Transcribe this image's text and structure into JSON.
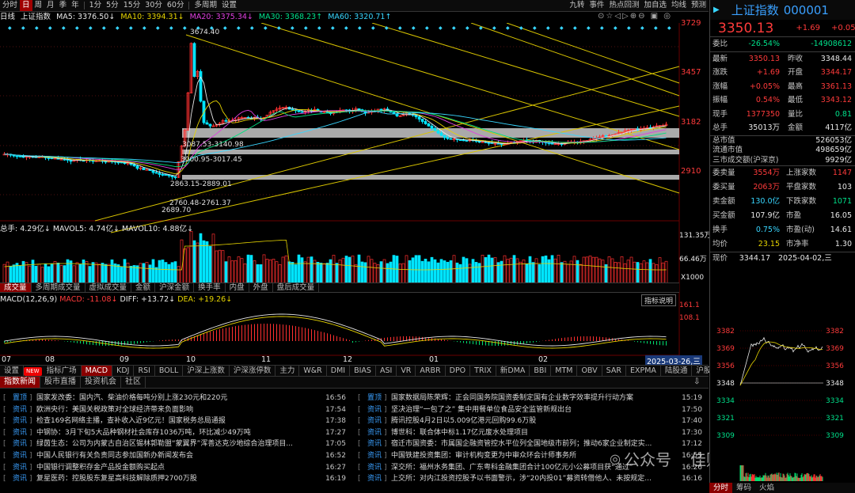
{
  "toolbar": {
    "items": [
      "分时",
      "日",
      "周",
      "月",
      "季",
      "年",
      "1分",
      "5分",
      "15分",
      "30分",
      "60分",
      "多周期",
      "设置"
    ],
    "active": "日",
    "right": [
      "九转",
      "事件",
      "热点回测",
      "加自选",
      "均线",
      "预测"
    ]
  },
  "ma_line": {
    "period": "日线",
    "title": "上证指数",
    "ma5": "MA5: 3376.50↓",
    "ma10": "MA10: 3394.31↓",
    "ma20": "MA20: 3375.34↓",
    "ma30": "MA30: 3368.23↑",
    "ma60": "MA60: 3320.71↑"
  },
  "price_axis": [
    "3729",
    "3457",
    "3182",
    "2910"
  ],
  "chart_annotations": {
    "high": "3674.40",
    "low": "2689.70",
    "zone1": "3087.53-3140.98",
    "zone2": "3000.95-3017.45",
    "zone3": "2863.15-2889.01",
    "zone4": "2760.48-2761.37"
  },
  "volume": {
    "header": "总手: 4.29亿↓  MAVOL5: 4.74亿↓  MAVOL10: 4.88亿↓",
    "axis": [
      "131.35万",
      "66.46万",
      "X1000"
    ]
  },
  "vol_tabs": [
    "成交量",
    "多周期成交量",
    "虚拟成交量",
    "金额",
    "沪深金额",
    "换手率",
    "内盘",
    "外盘",
    "盘后成交量"
  ],
  "macd": {
    "label": "MACD(12,26,9)",
    "macd": "MACD: -11.08↓",
    "diff": "DIFF: +13.72↓",
    "dea": "DEA: +19.26↓",
    "axis": [
      "161.1",
      "108.1"
    ],
    "explain": "指标说明"
  },
  "date_axis": [
    "07",
    "08",
    "09",
    "10",
    "11",
    "12",
    "01",
    "02"
  ],
  "current_date": "2025-03-26,三",
  "indicator_tabs": [
    "设置",
    "NEW",
    "指标广场",
    "MACD",
    "KDJ",
    "RSI",
    "BOLL",
    "沪深上涨数",
    "沪深涨停数",
    "主力",
    "W&R",
    "DMI",
    "BIAS",
    "ASI",
    "VR",
    "ARBR",
    "DPO",
    "TRIX",
    "新DMA",
    "BBI",
    "MTM",
    "OBV",
    "SAR",
    "EXPMA",
    "陆股通",
    "沪股通",
    "深"
  ],
  "news_tabs": [
    "指数新闻",
    "股市直播",
    "投资机会",
    "社区"
  ],
  "news_left": [
    {
      "tag": "置顶",
      "title": "国家发改委：国内汽、柴油价格每吨分别上涨230元和220元",
      "time": "16:56"
    },
    {
      "tag": "资讯",
      "title": "欧洲央行：美国关税政策对全球经济带来负面影响",
      "time": "17:54"
    },
    {
      "tag": "资讯",
      "title": "检查169名网络主播，查补收入近9亿元！国家税务总局通报",
      "time": "17:38"
    },
    {
      "tag": "资讯",
      "title": "中钢协：3月下旬5大品种钢材社会库存1036万吨，环比减少49万吨",
      "time": "17:27"
    },
    {
      "tag": "资讯",
      "title": "绿茵生态：公司为内蒙古自治区锡林郭勒盟“蒙翼界”浑善达克沙地综合治理项目...",
      "time": "17:05"
    },
    {
      "tag": "资讯",
      "title": "中国人民银行有关负责同志参加国新办新闻发布会",
      "time": "16:52"
    },
    {
      "tag": "资讯",
      "title": "中国银行调整积存金产品投金额购买起点",
      "time": "16:27"
    },
    {
      "tag": "资讯",
      "title": "复星医药：控股股东复星高科技解除质押2700万股",
      "time": "16:19"
    }
  ],
  "news_right": [
    {
      "tag": "置顶",
      "title": "国家数据局陈荣辉：正会同国务院国资委制定国有企业数字效率提升行动方案",
      "time": "15:19"
    },
    {
      "tag": "资讯",
      "title": "坚决治理“一包了之” 集中用餐单位食品安全监管新规出台",
      "time": "17:50"
    },
    {
      "tag": "资讯",
      "title": "腾讯控股4月2日以5.009亿港元回购99.6万股",
      "time": "17:40"
    },
    {
      "tag": "资讯",
      "title": "博世科：联合体中标1.17亿元废水处理项目",
      "time": "17:30"
    },
    {
      "tag": "资讯",
      "title": "宿迁市国资委：市属国企融资管控水平位列全国地级市前列；推动6家企业制定实...",
      "time": "17:12"
    },
    {
      "tag": "资讯",
      "title": "中国铁建投资集团：审计机构变更为中审众环会计师事务所",
      "time": "16:55"
    },
    {
      "tag": "资讯",
      "title": "深交所：福州水务集团、广东粤科金融集团合计100亿元小公募项目获“通过”",
      "time": "16:26"
    },
    {
      "tag": "资讯",
      "title": "上交所：对内江投资控股予以书面警示，涉“20内投01”募资转借他人、未按规定...",
      "time": "16:16"
    }
  ],
  "quote": {
    "name": "上证指数",
    "code": "000001",
    "price": "3350.13",
    "change": "+1.69",
    "pct": "+0.05%",
    "weibi": "-26.54%",
    "weicha": "-14908612",
    "rows": [
      {
        "l": "最新",
        "v": "3350.13",
        "l2": "昨收",
        "v2": "3348.44"
      },
      {
        "l": "涨跌",
        "v": "+1.69",
        "l2": "开盘",
        "v2": "3344.17"
      },
      {
        "l": "涨幅",
        "v": "+0.05%",
        "l2": "最高",
        "v2": "3361.13"
      },
      {
        "l": "振幅",
        "v": "0.54%",
        "l2": "最低",
        "v2": "3343.12"
      },
      {
        "l": "现手",
        "v": "1377350",
        "l2": "量比",
        "v2": "0.81"
      },
      {
        "l": "总手",
        "v": "35013万",
        "l2": "金额",
        "v2": "4117亿"
      }
    ],
    "market": [
      {
        "l": "总市值",
        "v": "526053亿"
      },
      {
        "l": "流通市值",
        "v": "498659亿"
      },
      {
        "l": "三市成交额(沪深京)",
        "v": "9929亿"
      }
    ],
    "breadth": [
      {
        "l": "委卖量",
        "v": "3554万",
        "l2": "上涨家数",
        "v2": "1147"
      },
      {
        "l": "委买量",
        "v": "2063万",
        "l2": "平盘家数",
        "v2": "103"
      },
      {
        "l": "卖金额",
        "v": "130.0亿",
        "l2": "下跌家数",
        "v2": "1071"
      },
      {
        "l": "买金额",
        "v": "107.9亿",
        "l2": "市盈",
        "v2": "16.05"
      },
      {
        "l": "换手",
        "v": "0.75%",
        "l2": "市盈(动)",
        "v2": "14.61"
      },
      {
        "l": "均价",
        "v": "23.15",
        "l2": "市净率",
        "v2": "1.30"
      }
    ],
    "now_label": "现价",
    "now_price": "3344.17",
    "now_date": "2025-04-02,三"
  },
  "mini_chart": {
    "y_left": [
      "3382",
      "3369",
      "3356",
      "3348",
      "3334",
      "3321",
      "3309"
    ],
    "y_right": [
      "1.15%",
      "0.76%",
      "0.38%",
      "0.00%",
      "0.38%",
      "0.76%",
      "1.15%"
    ]
  },
  "right_tabs": [
    "分时",
    "筹码",
    "火焰"
  ],
  "watermark": {
    "platform": "公众号",
    "account": "佳财一分钟"
  }
}
